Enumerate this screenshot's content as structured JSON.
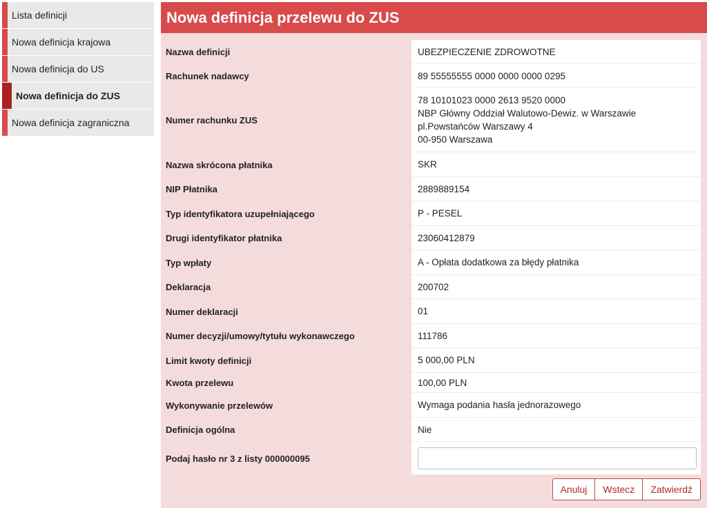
{
  "sidebar": {
    "items": [
      {
        "label": "Lista definicji"
      },
      {
        "label": "Nowa definicja krajowa"
      },
      {
        "label": "Nowa definicja do US"
      },
      {
        "label": "Nowa definicja do ZUS",
        "active": true
      },
      {
        "label": "Nowa definicja zagraniczna"
      }
    ]
  },
  "main": {
    "title": "Nowa definicja przelewu do ZUS",
    "fields": {
      "nazwa_definicji": {
        "label": "Nazwa definicji",
        "value": "UBEZPIECZENIE ZDROWOTNE"
      },
      "rachunek_nadawcy": {
        "label": "Rachunek nadawcy",
        "value": "89 55555555 0000 0000 0000 0295"
      },
      "numer_rachunku_zus": {
        "label": "Numer rachunku ZUS",
        "lines": [
          "78 10101023 0000 2613 9520 0000",
          "NBP Główny Oddział Walutowo-Dewiz. w Warszawie",
          "pl.Powstańców Warszawy 4",
          "00-950 Warszawa"
        ]
      },
      "nazwa_skrocona": {
        "label": "Nazwa skrócona płatnika",
        "value": "SKR"
      },
      "nip_platnika": {
        "label": "NIP Płatnika",
        "value": "2889889154"
      },
      "typ_identyfikatora": {
        "label": "Typ identyfikatora uzupełniającego",
        "value": "P - PESEL"
      },
      "drugi_identyfikator": {
        "label": "Drugi identyfikator płatnika",
        "value": "23060412879"
      },
      "typ_wplaty": {
        "label": "Typ wpłaty",
        "value": "A - Opłata dodatkowa za błędy płatnika"
      },
      "deklaracja": {
        "label": "Deklaracja",
        "value": "200702"
      },
      "numer_deklaracji": {
        "label": "Numer deklaracji",
        "value": "01"
      },
      "numer_decyzji": {
        "label": "Numer decyzji/umowy/tytułu wykonawczego",
        "value": "111786"
      },
      "limit_kwoty": {
        "label": "Limit kwoty definicji",
        "value": "5 000,00 PLN"
      },
      "kwota_przelewu": {
        "label": "Kwota przelewu",
        "value": "100,00 PLN"
      },
      "wykonywanie": {
        "label": "Wykonywanie przelewów",
        "value": "Wymaga podania hasła jednorazowego"
      },
      "definicja_ogolna": {
        "label": "Definicja ogólna",
        "value": "Nie"
      },
      "haslo": {
        "label": "Podaj hasło nr 3 z listy 000000095",
        "value": ""
      }
    }
  },
  "buttons": {
    "cancel": "Anuluj",
    "back": "Wstecz",
    "confirm": "Zatwierdź"
  },
  "colors": {
    "accent": "#d94a4a",
    "accent_dark": "#a82323",
    "panel_bg": "#f4dcdc"
  }
}
